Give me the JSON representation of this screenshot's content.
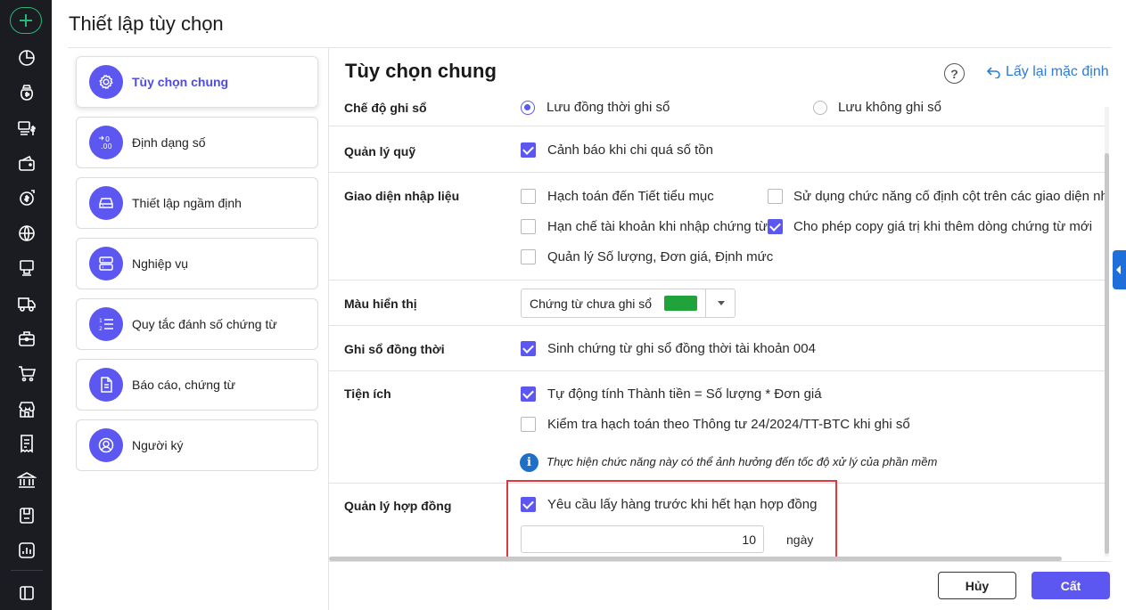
{
  "header": {
    "title": "Thiết lập tùy chọn"
  },
  "rail": {
    "icons": [
      "add-icon",
      "pie-chart-icon",
      "money-bag-icon",
      "cash-transfer-icon",
      "wallet-icon",
      "dollar-cycle-icon",
      "globe-icon",
      "stamp-icon",
      "truck-icon",
      "briefcase-icon",
      "cart-icon",
      "store-icon",
      "receipt-icon",
      "bank-icon",
      "document-box-icon",
      "report-chart-icon",
      "collapse-icon"
    ]
  },
  "menu": {
    "items": [
      {
        "label": "Tùy chọn chung",
        "icon": "gear-icon",
        "active": true
      },
      {
        "label": "Định dạng số",
        "icon": "number-format-icon"
      },
      {
        "label": "Thiết lập ngầm định",
        "icon": "drive-icon"
      },
      {
        "label": "Nghiệp vụ",
        "icon": "server-icon"
      },
      {
        "label": "Quy tắc đánh số chứng từ",
        "icon": "numbered-list-icon"
      },
      {
        "label": "Báo cáo, chứng từ",
        "icon": "document-icon"
      },
      {
        "label": "Người ký",
        "icon": "user-icon"
      }
    ]
  },
  "panel": {
    "title": "Tùy chọn chung",
    "help_label": "?",
    "reset_label": "Lấy lại mặc định"
  },
  "settings": {
    "che_do": {
      "label": "Chế độ ghi sổ",
      "option1": "Lưu đồng thời ghi sổ",
      "option2": "Lưu không ghi sổ"
    },
    "quan_ly_quy": {
      "label": "Quản lý quỹ",
      "option1": "Cảnh báo khi chi quá số tồn"
    },
    "giao_dien": {
      "label": "Giao diện nhập liệu",
      "option1": "Hạch toán đến Tiết tiểu mục",
      "option2": "Sử dụng chức năng cố định cột trên các giao diện nh",
      "option3": "Hạn chế tài khoản khi nhập chứng từ",
      "option4": "Cho phép copy giá trị khi thêm dòng chứng từ mới",
      "option5": "Quản lý Số lượng, Đơn giá, Định mức"
    },
    "mau_hien_thi": {
      "label": "Màu hiển thị",
      "selected": "Chứng từ chưa ghi sổ",
      "swatch_color": "#1fa33a"
    },
    "ghi_so": {
      "label": "Ghi sổ đồng thời",
      "option1": "Sinh chứng từ ghi sổ đồng thời tài khoản 004"
    },
    "tien_ich": {
      "label": "Tiện ích",
      "option1": "Tự động tính Thành tiền = Số lượng * Đơn giá",
      "option2": "Kiểm tra hạch toán theo Thông tư 24/2024/TT-BTC khi ghi sổ",
      "info_icon": "i",
      "info": "Thực hiện chức năng này có thể ảnh hưởng đến tốc độ xử lý của phần mềm"
    },
    "hop_dong": {
      "label": "Quản lý hợp đồng",
      "option1": "Yêu cầu lấy hàng trước khi hết hạn hợp đồng",
      "days_value": "10",
      "days_unit": "ngày"
    }
  },
  "footer": {
    "cancel_label": "Hủy",
    "save_label": "Cất"
  },
  "colors": {
    "accent": "#5b57f0",
    "link": "#2e7bd6",
    "highlight": "#e0383e",
    "rail": "#1b1c22"
  }
}
